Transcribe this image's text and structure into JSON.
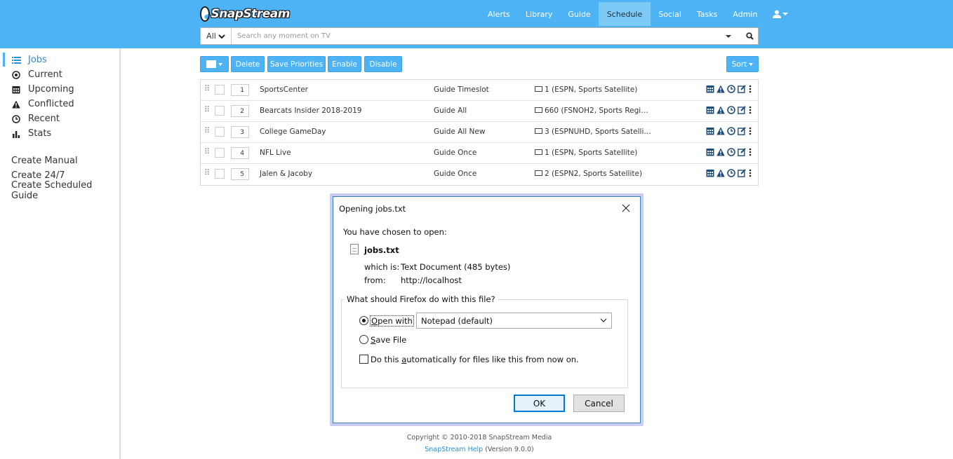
{
  "brand": {
    "name": "SnapStream"
  },
  "nav": {
    "items": [
      "Alerts",
      "Library",
      "Guide",
      "Schedule",
      "Social",
      "Tasks",
      "Admin"
    ],
    "active": "Schedule"
  },
  "search": {
    "scope": "All",
    "placeholder": "Search any moment on TV"
  },
  "sidebar": {
    "items": [
      {
        "label": "Jobs",
        "icon": "list-icon"
      },
      {
        "label": "Current",
        "icon": "target-icon"
      },
      {
        "label": "Upcoming",
        "icon": "calendar-icon"
      },
      {
        "label": "Conflicted",
        "icon": "warning-icon"
      },
      {
        "label": "Recent",
        "icon": "clock-icon"
      },
      {
        "label": "Stats",
        "icon": "bar-chart-icon"
      }
    ],
    "links": [
      "Create Manual",
      "Create 24/7",
      "Create Scheduled Guide"
    ]
  },
  "toolbar": {
    "delete": "Delete",
    "save_priorities": "Save Priorities",
    "enable": "Enable",
    "disable": "Disable",
    "sort": "Sort"
  },
  "jobs": [
    {
      "priority": "1",
      "name": "SportsCenter",
      "type": "Guide Timeslot",
      "channel": "1 (ESPN, Sports Satellite)"
    },
    {
      "priority": "2",
      "name": "Bearcats Insider 2018-2019",
      "type": "Guide All",
      "channel": "660 (FSNOH2, Sports Regi…"
    },
    {
      "priority": "3",
      "name": "College GameDay",
      "type": "Guide All New",
      "channel": "3 (ESPNUHD, Sports Satelli…"
    },
    {
      "priority": "4",
      "name": "NFL Live",
      "type": "Guide Once",
      "channel": "1 (ESPN, Sports Satellite)"
    },
    {
      "priority": "5",
      "name": "Jalen & Jacoby",
      "type": "Guide Once",
      "channel": "2 (ESPN2, Sports Satellite)"
    }
  ],
  "dialog": {
    "title": "Opening jobs.txt",
    "lead": "You have chosen to open:",
    "file_name": "jobs.txt",
    "which_label": "which is:",
    "which_value": "Text Document (485 bytes)",
    "from_label": "from:",
    "from_value": "http://localhost",
    "question": "What should Firefox do with this file?",
    "open_with_prefix": "O",
    "open_with_rest": "pen with",
    "app": "Notepad (default)",
    "save_prefix": "S",
    "save_rest": "ave File",
    "auto_a": "Do this ",
    "auto_u": "a",
    "auto_b": "utomatically for files like this from now on.",
    "ok": "OK",
    "cancel": "Cancel",
    "selected_option": "Open with"
  },
  "footer": {
    "copyright": "Copyright © 2010-2018 SnapStream Media",
    "help": "SnapStream Help",
    "version": "(Version 9.0.0)"
  },
  "colors": {
    "brand_blue": "#4db3f5",
    "active_tab": "#7dcaf6",
    "link": "#2d8fd3",
    "icon_dark": "#1f4e79"
  }
}
